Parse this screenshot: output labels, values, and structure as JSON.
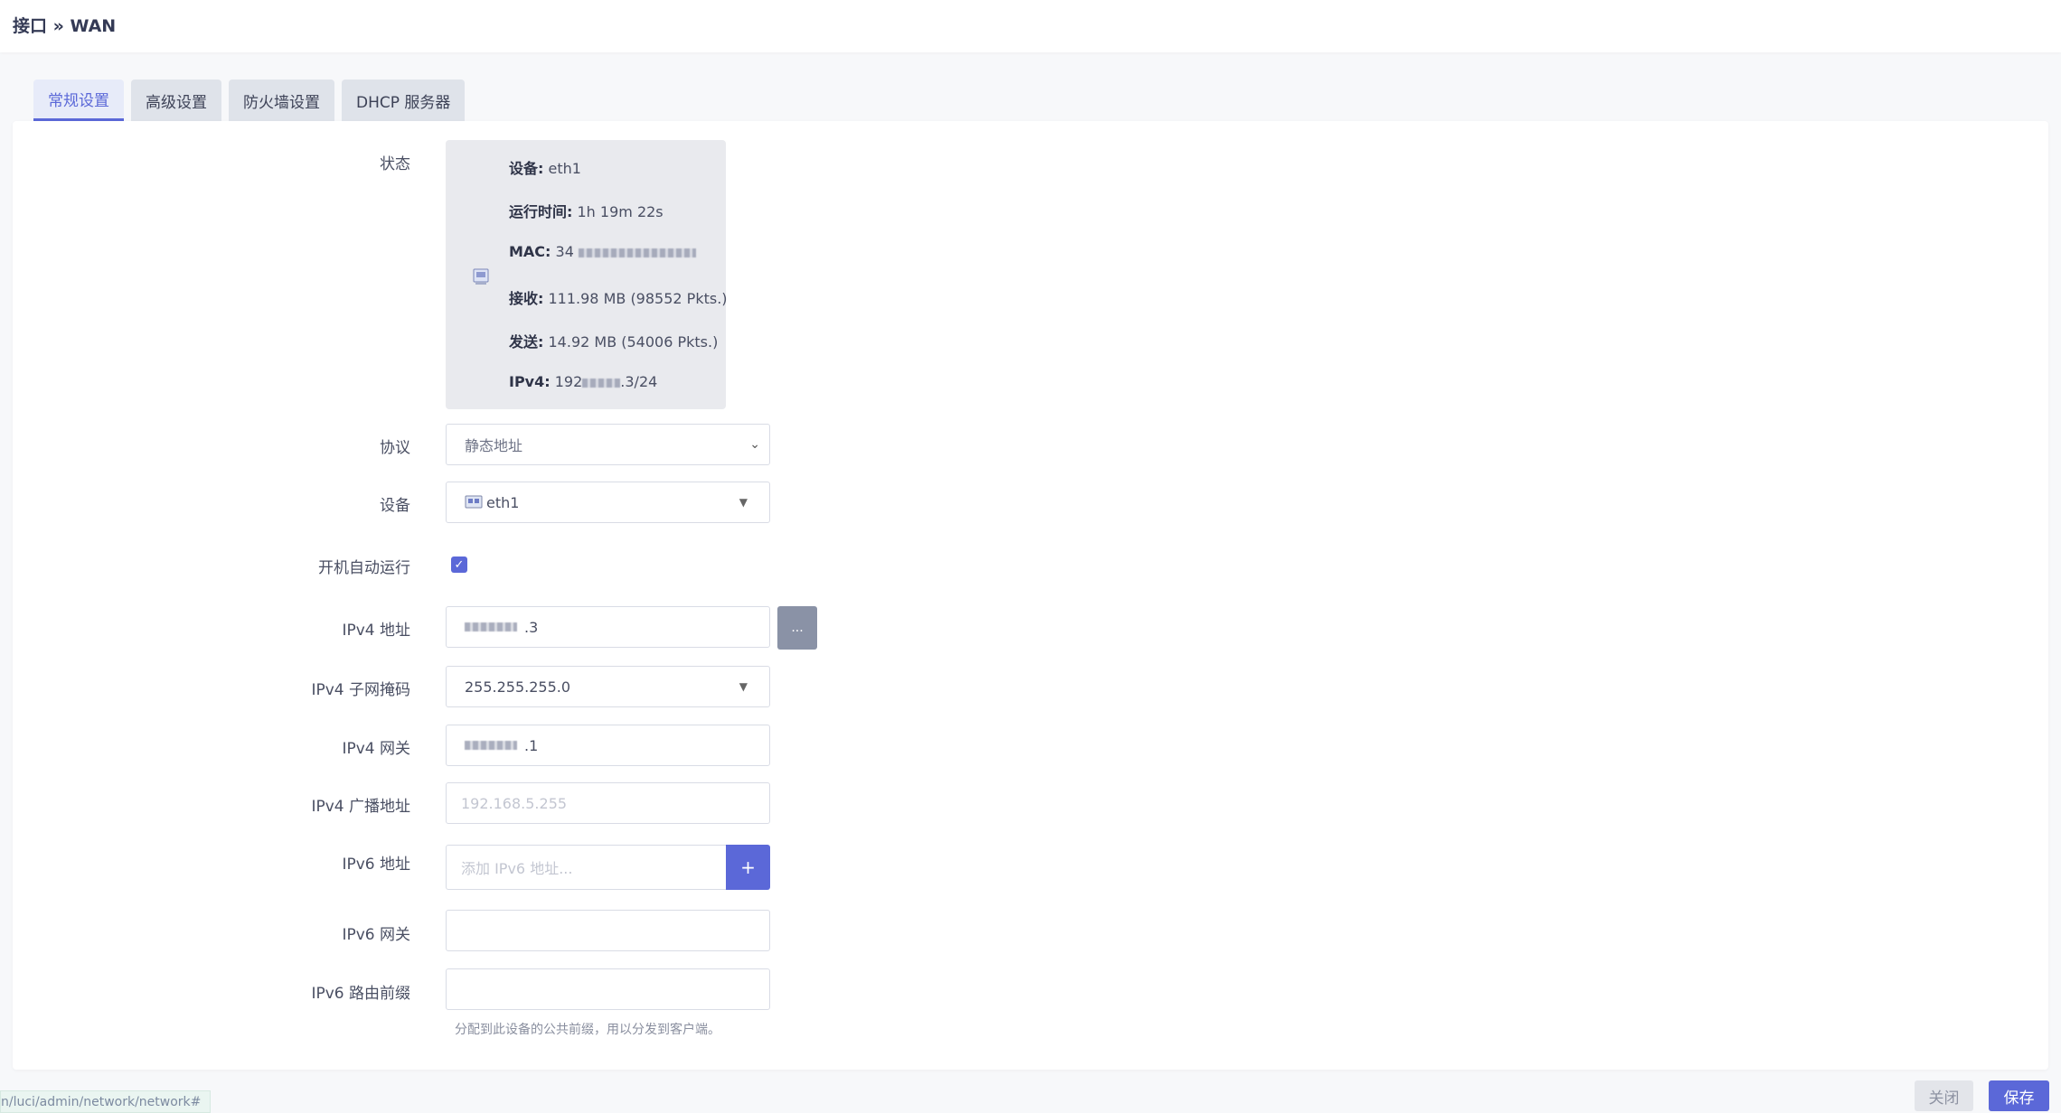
{
  "page": {
    "title": "接口 » WAN"
  },
  "tabs": [
    {
      "label": "常规设置",
      "active": true
    },
    {
      "label": "高级设置",
      "active": false
    },
    {
      "label": "防火墙设置",
      "active": false
    },
    {
      "label": "DHCP 服务器",
      "active": false
    }
  ],
  "labels": {
    "status": "状态",
    "protocol": "协议",
    "device": "设备",
    "autostart": "开机自动运行",
    "ipv4_address": "IPv4 地址",
    "ipv4_netmask": "IPv4 子网掩码",
    "ipv4_gateway": "IPv4 网关",
    "ipv4_broadcast": "IPv4 广播地址",
    "ipv6_address": "IPv6 地址",
    "ipv6_gateway": "IPv6 网关",
    "ipv6_prefix": "IPv6 路由前缀"
  },
  "status": {
    "device_key": "设备:",
    "device_val": "eth1",
    "uptime_key": "运行时间:",
    "uptime_val": "1h 19m 22s",
    "mac_key": "MAC:",
    "mac_val": "34",
    "rx_key": "接收:",
    "rx_val": "111.98 MB (98552 Pkts.)",
    "tx_key": "发送:",
    "tx_val": "14.92 MB (54006 Pkts.)",
    "ipv4_key": "IPv4:",
    "ipv4_prefix": "192",
    "ipv4_suffix": ".3/24"
  },
  "fields": {
    "protocol_value": "静态地址",
    "device_value": "eth1",
    "autostart_checked": true,
    "ipv4_address_suffix": ".3",
    "more_button": "...",
    "netmask_value": "255.255.255.0",
    "gateway_suffix": ".1",
    "broadcast_placeholder": "192.168.5.255",
    "ipv6_address_placeholder": "添加 IPv6 地址...",
    "add_button": "+",
    "ipv6_prefix_hint": "分配到此设备的公共前缀，用以分发到客户端。"
  },
  "footer": {
    "url": "n/luci/admin/network/network#",
    "close_label": "关闭",
    "save_label": "保存"
  },
  "colors": {
    "accent": "#5b68d8",
    "status_card_bg": "#e9eaee"
  },
  "icons": {
    "status_icon": "ethernet-port-icon",
    "device_icon": "ethernet-port-icon",
    "checkbox": "check-icon"
  }
}
